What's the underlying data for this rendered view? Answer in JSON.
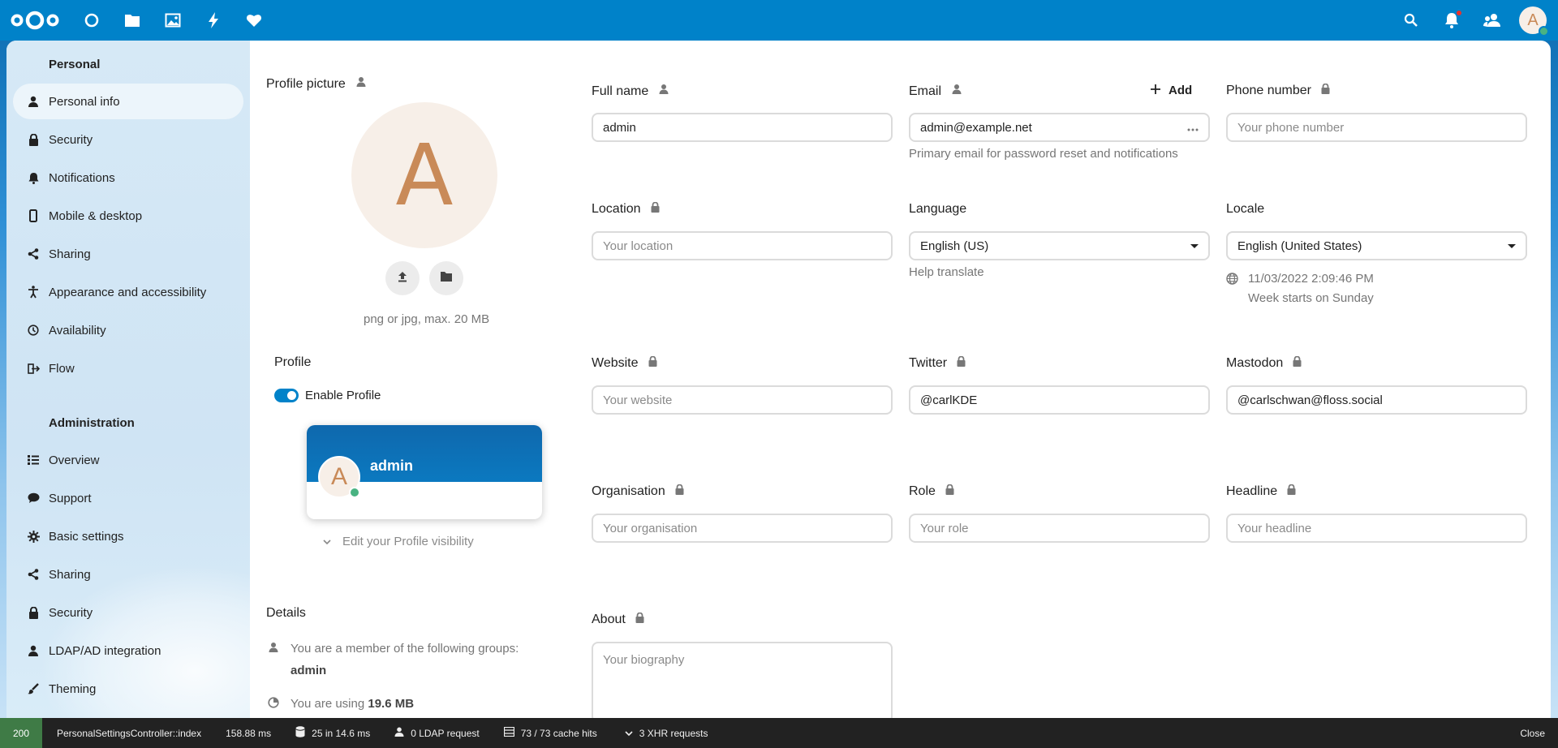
{
  "header": {
    "apps": [
      {
        "name": "dashboard-icon"
      },
      {
        "name": "files-icon"
      },
      {
        "name": "photos-icon"
      },
      {
        "name": "activity-icon"
      },
      {
        "name": "favorites-icon"
      }
    ],
    "avatar_letter": "A"
  },
  "sidebar": {
    "personal_caption": "Personal",
    "personal_items": [
      {
        "label": "Personal info",
        "icon": "user-icon"
      },
      {
        "label": "Security",
        "icon": "lock-icon"
      },
      {
        "label": "Notifications",
        "icon": "bell-icon"
      },
      {
        "label": "Mobile & desktop",
        "icon": "phone-icon"
      },
      {
        "label": "Sharing",
        "icon": "share-icon"
      },
      {
        "label": "Appearance and accessibility",
        "icon": "accessibility-icon"
      },
      {
        "label": "Availability",
        "icon": "clock-icon"
      },
      {
        "label": "Flow",
        "icon": "flow-icon"
      }
    ],
    "admin_caption": "Administration",
    "admin_items": [
      {
        "label": "Overview",
        "icon": "list-icon"
      },
      {
        "label": "Support",
        "icon": "chat-icon"
      },
      {
        "label": "Basic settings",
        "icon": "gear-icon"
      },
      {
        "label": "Sharing",
        "icon": "share-icon"
      },
      {
        "label": "Security",
        "icon": "lock-icon"
      },
      {
        "label": "LDAP/AD integration",
        "icon": "user-icon"
      },
      {
        "label": "Theming",
        "icon": "brush-icon"
      }
    ]
  },
  "profile_picture": {
    "label": "Profile picture",
    "letter": "A",
    "hint": "png or jpg, max. 20 MB"
  },
  "profile": {
    "label": "Profile",
    "enable_label": "Enable Profile",
    "card_name": "admin",
    "card_letter": "A",
    "visibility_label": "Edit your Profile visibility"
  },
  "details": {
    "label": "Details",
    "groups_text": "You are a member of the following groups:",
    "groups_value": "admin",
    "usage_prefix": "You are using",
    "usage_value": "19.6 MB"
  },
  "fields": {
    "full_name": {
      "label": "Full name",
      "value": "admin"
    },
    "email": {
      "label": "Email",
      "value": "admin@example.net",
      "add_label": "Add",
      "hint": "Primary email for password reset and notifications"
    },
    "phone": {
      "label": "Phone number",
      "placeholder": "Your phone number"
    },
    "location": {
      "label": "Location",
      "placeholder": "Your location"
    },
    "language": {
      "label": "Language",
      "value": "English (US)",
      "help": "Help translate"
    },
    "locale": {
      "label": "Locale",
      "value": "English (United States)",
      "datetime": "11/03/2022 2:09:46 PM",
      "week": "Week starts on Sunday"
    },
    "website": {
      "label": "Website",
      "placeholder": "Your website"
    },
    "twitter": {
      "label": "Twitter",
      "value": "@carlKDE"
    },
    "mastodon": {
      "label": "Mastodon",
      "value": "@carlschwan@floss.social"
    },
    "organisation": {
      "label": "Organisation",
      "placeholder": "Your organisation"
    },
    "role": {
      "label": "Role",
      "placeholder": "Your role"
    },
    "headline": {
      "label": "Headline",
      "placeholder": "Your headline"
    },
    "about": {
      "label": "About",
      "placeholder": "Your biography"
    }
  },
  "debugbar": {
    "status": "200",
    "controller": "PersonalSettingsController::index",
    "time": "158.88 ms",
    "queries": "25 in 14.6 ms",
    "ldap": "0 LDAP request",
    "cache": "73 / 73 cache hits",
    "xhr": "3 XHR requests",
    "close": "Close"
  }
}
